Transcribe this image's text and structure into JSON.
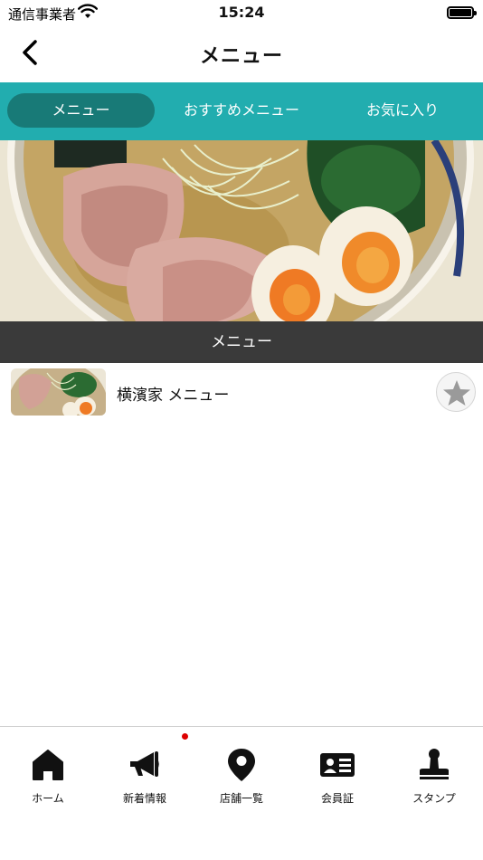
{
  "status_bar": {
    "carrier": "通信事業者",
    "time": "15:24"
  },
  "nav": {
    "title": "メニュー",
    "back_icon": "chevron-left-icon"
  },
  "tabs": [
    {
      "label": "メニュー",
      "active": true
    },
    {
      "label": "おすすめメニュー",
      "active": false
    },
    {
      "label": "お気に入り",
      "active": false
    }
  ],
  "colors": {
    "accent": "#22adaf",
    "active_tab": "#187a77",
    "section_header": "#3a3a3a",
    "notification": "#dd0000"
  },
  "section": {
    "title": "メニュー"
  },
  "menu_items": [
    {
      "name": "横濱家 メニュー",
      "favorite_icon": "star-icon"
    }
  ],
  "bottom_nav": [
    {
      "label": "ホーム",
      "icon": "home-icon"
    },
    {
      "label": "新着情報",
      "icon": "megaphone-icon",
      "has_notification": true
    },
    {
      "label": "店舗一覧",
      "icon": "location-pin-icon"
    },
    {
      "label": "会員証",
      "icon": "member-card-icon"
    },
    {
      "label": "スタンプ",
      "icon": "stamp-icon"
    }
  ]
}
